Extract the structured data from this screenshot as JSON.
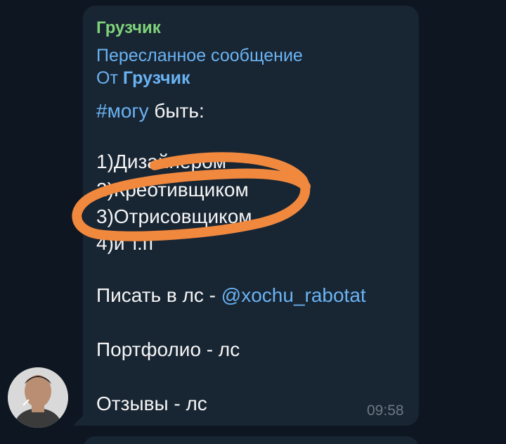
{
  "message": {
    "sender": "Грузчик",
    "forwarded_label": "Пересланное сообщение",
    "forwarded_from_prefix": "От",
    "forwarded_from_name": "Грузчик",
    "hashtag": "#могу",
    "first_line_rest": " быть:",
    "list": [
      "1)Дизайнером",
      "2)Креотивщиком",
      "3)Отрисовщиком",
      "4)и т.п"
    ],
    "write_prefix": "Писать в лс - ",
    "write_mention": "@xochu_rabotat",
    "portfolio": "Портфолио - лс",
    "reviews": "Отзывы - лс",
    "time": "09:58"
  },
  "colors": {
    "background": "#0e1621",
    "bubble": "#182533",
    "sender": "#7fd37a",
    "link": "#6ab3f3",
    "text": "#f5f5f5",
    "time": "#6c7883",
    "scribble": "#f0883e"
  },
  "avatar": {
    "icon": "user-avatar-photo"
  }
}
